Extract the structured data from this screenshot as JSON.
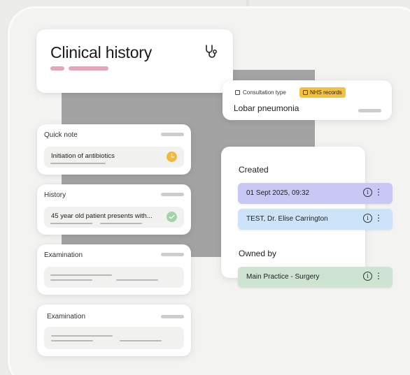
{
  "clinical_history": {
    "title": "Clinical history",
    "icon": "stethoscope-icon"
  },
  "quick_note": {
    "label": "Quick note",
    "value": "Initiation of antibiotics",
    "status_color": "#f5b83c"
  },
  "history": {
    "label": "History",
    "value": "45 year old patient presents with...",
    "status_color": "#9fd6a4"
  },
  "examination_1": {
    "label": "Examination"
  },
  "examination_2": {
    "label": "Examination"
  },
  "consultation": {
    "type_label": "Consultation type",
    "badge_label": "NHS records",
    "value": "Lobar pneumonia"
  },
  "details": {
    "created_label": "Created",
    "created_date": "01 Sept 2025, 09:32",
    "created_by": "TEST, Dr. Elise Carrington",
    "owned_label": "Owned by",
    "owner": "Main Practice - Surgery",
    "info_glyph": "i",
    "menu_glyph": "⋮"
  },
  "colors": {
    "accent_pink": "#e7a4bc",
    "nhs_badge": "#f4c13e",
    "chip_purple": "#c9c8f5",
    "chip_blue": "#cde3f9",
    "chip_green": "#cfe3d3"
  }
}
